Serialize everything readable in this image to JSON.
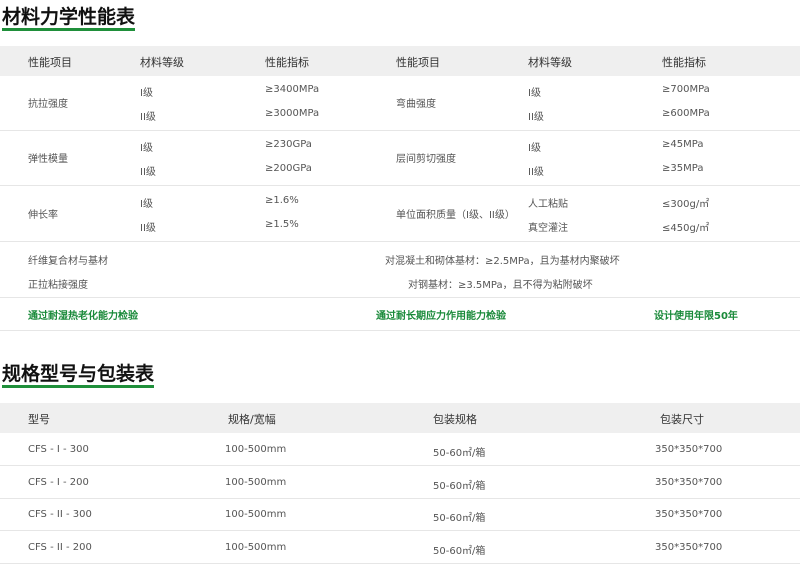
{
  "section1": {
    "title": "材料力学性能表",
    "headers": [
      "性能项目",
      "材料等级",
      "性能指标",
      "性能项目",
      "材料等级",
      "性能指标"
    ],
    "rows": [
      {
        "left": {
          "name": "抗拉强度",
          "grades": [
            "I级",
            "II级"
          ],
          "values": [
            "≥3400MPa",
            "≥3000MPa"
          ]
        },
        "right": {
          "name": "弯曲强度",
          "grades": [
            "I级",
            "II级"
          ],
          "values": [
            "≥700MPa",
            "≥600MPa"
          ]
        }
      },
      {
        "left": {
          "name": "弹性模量",
          "grades": [
            "I级",
            "II级"
          ],
          "values": [
            "≥230GPa",
            "≥200GPa"
          ]
        },
        "right": {
          "name": "层间剪切强度",
          "grades": [
            "I级",
            "II级"
          ],
          "values": [
            "≥45MPa",
            "≥35MPa"
          ]
        }
      },
      {
        "left": {
          "name": "伸长率",
          "grades": [
            "I级",
            "II级"
          ],
          "values": [
            "≥1.6%",
            "≥1.5%"
          ]
        },
        "right": {
          "name": "单位面积质量（I级、II级）",
          "grades": [
            "人工粘贴",
            "真空灌注"
          ],
          "values": [
            "≤300g/㎡",
            "≤450g/㎡"
          ]
        }
      }
    ],
    "bond": {
      "label1": "纤维复合材与基材",
      "label2": "正拉粘接强度",
      "value1": "对混凝土和砌体基材：≥2.5MPa，且为基材内聚破坏",
      "value2": "对钢基材：≥3.5MPa，且不得为粘附破坏"
    },
    "green": [
      "通过耐湿热老化能力检验",
      "通过耐长期应力作用能力检验",
      "设计使用年限50年"
    ]
  },
  "section2": {
    "title": "规格型号与包装表",
    "headers": [
      "型号",
      "规格/宽幅",
      "包装规格",
      "包装尺寸"
    ],
    "rows": [
      [
        "CFS - I - 300",
        "100-500mm",
        "50-60㎡/箱",
        "350*350*700"
      ],
      [
        "CFS - I - 200",
        "100-500mm",
        "50-60㎡/箱",
        "350*350*700"
      ],
      [
        "CFS - II - 300",
        "100-500mm",
        "50-60㎡/箱",
        "350*350*700"
      ],
      [
        "CFS - II - 200",
        "100-500mm",
        "50-60㎡/箱",
        "350*350*700"
      ]
    ]
  }
}
